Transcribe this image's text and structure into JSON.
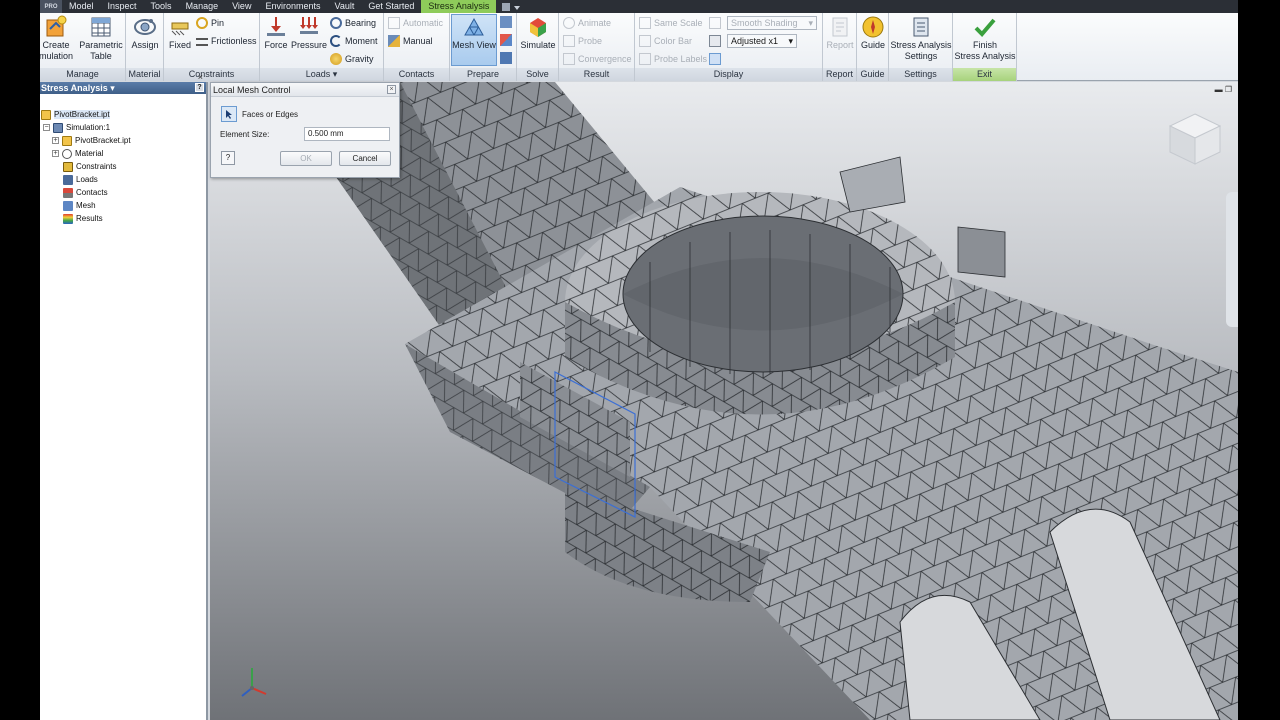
{
  "menubar": {
    "app_button": "PRO",
    "tabs": [
      "Model",
      "Inspect",
      "Tools",
      "Manage",
      "View",
      "Environments",
      "Vault",
      "Get Started",
      "Stress Analysis"
    ],
    "active_tab": "Stress Analysis"
  },
  "ribbon": {
    "manage": {
      "label": "Manage",
      "create_simulation": "Create\nSimulation",
      "create_simulation_visible": "Create\nmulation",
      "parametric_table": "Parametric\nTable"
    },
    "material": {
      "label": "Material",
      "assign": "Assign"
    },
    "constraints": {
      "label": "Constraints",
      "fixed": "Fixed",
      "pin": "Pin",
      "frictionless": "Frictionless"
    },
    "loads": {
      "label": "Loads",
      "force": "Force",
      "pressure": "Pressure",
      "bearing": "Bearing",
      "moment": "Moment",
      "gravity": "Gravity"
    },
    "contacts": {
      "label": "Contacts",
      "automatic": "Automatic",
      "manual": "Manual"
    },
    "prepare": {
      "label": "Prepare",
      "mesh_view": "Mesh View"
    },
    "solve": {
      "label": "Solve",
      "simulate": "Simulate"
    },
    "result": {
      "label": "Result",
      "animate": "Animate",
      "probe": "Probe",
      "convergence": "Convergence"
    },
    "display": {
      "label": "Display",
      "same_scale": "Same Scale",
      "color_bar": "Color Bar",
      "probe_labels": "Probe Labels",
      "smooth_shading": "Smooth Shading",
      "adjusted": "Adjusted x1"
    },
    "report": {
      "label": "Report",
      "report": "Report"
    },
    "guide": {
      "label": "Guide",
      "guide": "Guide"
    },
    "settings": {
      "label": "Settings",
      "stress_analysis_settings": "Stress Analysis\nSettings"
    },
    "exit": {
      "label": "Exit",
      "finish": "Finish\nStress Analysis"
    }
  },
  "browser": {
    "title": "Stress Analysis",
    "items": [
      {
        "label": "PivotBracket.ipt",
        "icon": "part-icon"
      },
      {
        "label": "Simulation:1",
        "icon": "simulation-icon"
      },
      {
        "label": "PivotBracket.ipt",
        "icon": "part-icon"
      },
      {
        "label": "Material",
        "icon": "material-icon"
      },
      {
        "label": "Constraints",
        "icon": "constraints-icon"
      },
      {
        "label": "Loads",
        "icon": "loads-icon"
      },
      {
        "label": "Contacts",
        "icon": "contacts-icon"
      },
      {
        "label": "Mesh",
        "icon": "mesh-icon"
      },
      {
        "label": "Results",
        "icon": "results-icon"
      }
    ]
  },
  "dialog": {
    "title": "Local Mesh Control",
    "faces_or_edges": "Faces or Edges",
    "element_size_label": "Element Size:",
    "element_size_value": "0.500 mm",
    "ok": "OK",
    "cancel": "Cancel"
  },
  "colors": {
    "active_tab": "#8ecb5a",
    "browser_header": "#4a6d99",
    "mesh_face": "#9a9ea4",
    "mesh_edge": "#2c2f33",
    "selection": "#3b6fd6"
  }
}
